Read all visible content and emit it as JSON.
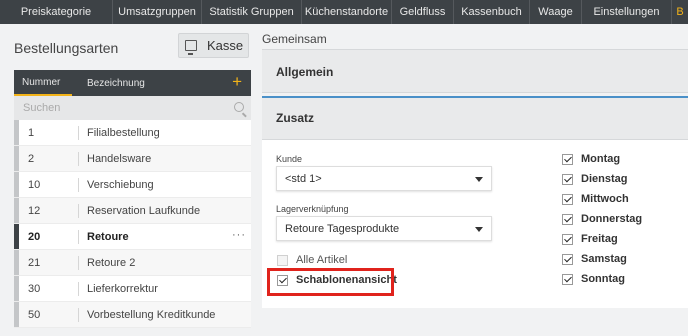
{
  "nav": {
    "tabs": [
      {
        "label": "Preiskategorie",
        "active": false
      },
      {
        "label": "Umsatzgruppen",
        "active": false
      },
      {
        "label": "Statistik Gruppen",
        "active": false
      },
      {
        "label": "Küchenstandorte",
        "active": false
      },
      {
        "label": "Geldfluss",
        "active": false
      },
      {
        "label": "Kassenbuch",
        "active": false
      },
      {
        "label": "Waage",
        "active": false
      },
      {
        "label": "Einstellungen",
        "active": false
      },
      {
        "label": "B",
        "active": true
      }
    ],
    "active_color": "#f3b319"
  },
  "left": {
    "title": "Bestellungsarten",
    "kasse_button": {
      "label": "Kasse",
      "icon": "monitor-icon"
    },
    "table": {
      "col_number": "Nummer",
      "col_name": "Bezeichnung",
      "add_icon": "+",
      "search_placeholder": "Suchen",
      "rows": [
        {
          "num": "1",
          "name": "Filialbestellung",
          "selected": false
        },
        {
          "num": "2",
          "name": "Handelsware",
          "selected": false
        },
        {
          "num": "10",
          "name": "Verschiebung",
          "selected": false
        },
        {
          "num": "12",
          "name": "Reservation Laufkunde",
          "selected": false
        },
        {
          "num": "20",
          "name": "Retoure",
          "selected": true,
          "menu": "···"
        },
        {
          "num": "21",
          "name": "Retoure 2",
          "selected": false
        },
        {
          "num": "30",
          "name": "Lieferkorrektur",
          "selected": false
        },
        {
          "num": "50",
          "name": "Vorbestellung Kreditkunde",
          "selected": false
        }
      ]
    }
  },
  "right": {
    "section": "Gemeinsam",
    "allgemein": "Allgemein",
    "zusatz": {
      "title": "Zusatz",
      "kunde_label": "Kunde",
      "kunde_value": "<std 1>",
      "lager_label": "Lagerverknüpfung",
      "lager_value": "Retoure Tagesprodukte",
      "alle_artikel": {
        "label": "Alle Artikel",
        "checked": false
      },
      "schablone": {
        "label": "Schablonenansicht",
        "checked": true
      },
      "days": [
        {
          "label": "Montag",
          "checked": true
        },
        {
          "label": "Dienstag",
          "checked": true
        },
        {
          "label": "Mittwoch",
          "checked": true
        },
        {
          "label": "Donnerstag",
          "checked": true
        },
        {
          "label": "Freitag",
          "checked": true
        },
        {
          "label": "Samstag",
          "checked": true
        },
        {
          "label": "Sonntag",
          "checked": true
        }
      ]
    },
    "highlight_color": "#e0231c"
  }
}
